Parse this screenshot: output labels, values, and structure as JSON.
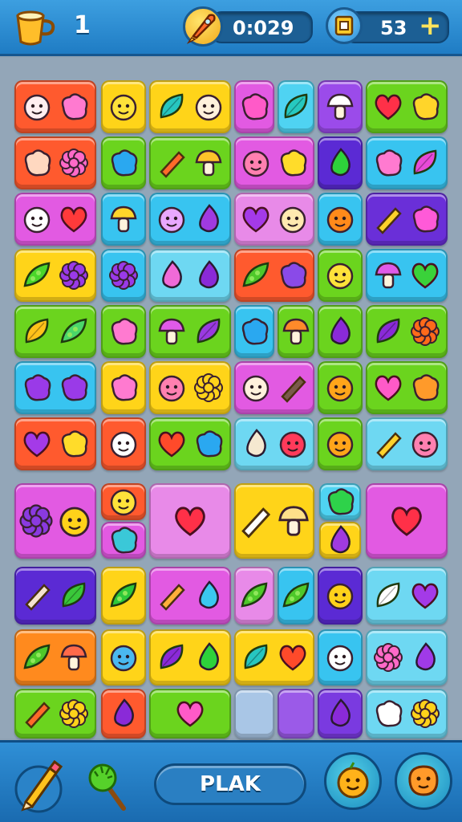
{
  "hud": {
    "level": "1",
    "timer": "0:029",
    "coins": "53"
  },
  "buttons": {
    "main": "PLAK"
  },
  "icons": {
    "top": [
      "cup-icon",
      "rocket-icon",
      "coin-icon",
      "add-icon"
    ],
    "bottom": [
      "pencil-tool-icon",
      "brush-tool-icon",
      "pumpkin-face-icon",
      "orange-face-icon"
    ]
  },
  "colors": {
    "bar": "#1f7cc4",
    "board": "#93a6b8",
    "red": "#ff4b2f",
    "yellow": "#ffd21a",
    "pink": "#e85ad8",
    "cyan": "#35c8f0",
    "green": "#5fd11c",
    "purple": "#7d35e0",
    "orange": "#ff7a1a"
  },
  "tiles": [
    {
      "c": "#ff5a2e",
      "s": [
        "smile-ghost",
        "pink-blob"
      ]
    },
    {
      "c": "#ffd419",
      "s": [
        "yellow-face"
      ]
    },
    {
      "c": "#ffd419",
      "s": [
        "teal-leaf",
        "cream-face"
      ]
    },
    {
      "c": "#e25ae2",
      "s": [
        "pink-splat"
      ]
    },
    {
      "c": "#4fd3f2",
      "s": [
        "teal-leaf-small"
      ]
    },
    {
      "c": "#9b4bea",
      "s": [
        "white-mushroom"
      ]
    },
    {
      "c": "#6bd41e",
      "s": [
        "red-heart",
        "yellow-blob"
      ]
    },
    {
      "c": "#ff5a2e",
      "s": [
        "peach-ghost",
        "pink-flower"
      ]
    },
    {
      "c": "#6bd41e",
      "s": [
        "blue-blob"
      ]
    },
    {
      "c": "#6bd41e",
      "s": [
        "carrot",
        "golden-bell"
      ]
    },
    {
      "c": "#e25ae2",
      "s": [
        "pink-face",
        "yellow-duck"
      ]
    },
    {
      "c": "#5b2ad4",
      "s": [
        "green-drop"
      ]
    },
    {
      "c": "#38c4f0",
      "s": [
        "pink-blob",
        "pink-leaf"
      ]
    },
    {
      "c": "#e25ae2",
      "s": [
        "white-cat",
        "strawberry"
      ]
    },
    {
      "c": "#38c4f0",
      "s": [
        "honey-jar"
      ]
    },
    {
      "c": "#38c4f0",
      "s": [
        "striped-ball",
        "purple-bean"
      ]
    },
    {
      "c": "#e88ae8",
      "s": [
        "purple-heart",
        "cookie"
      ]
    },
    {
      "c": "#38c4f0",
      "s": [
        "orange-pumpkin"
      ]
    },
    {
      "c": "#6a2fd8",
      "s": [
        "corn",
        "pink-cloud"
      ]
    },
    {
      "c": "#ffd419",
      "s": [
        "green-corn",
        "purple-flower"
      ]
    },
    {
      "c": "#38c4f0",
      "s": [
        "purple-flower"
      ]
    },
    {
      "c": "#6ed8f2",
      "s": [
        "pink-bean",
        "purple-eggplant"
      ]
    },
    {
      "c": "#ff5a2e",
      "s": [
        "pea-pod",
        "purple-blob"
      ]
    },
    {
      "c": "#6bd41e",
      "s": [
        "yellow-face"
      ]
    },
    {
      "c": "#38c4f0",
      "s": [
        "pink-mushroom",
        "green-tulip"
      ]
    },
    {
      "c": "#6bd41e",
      "s": [
        "yellow-leaf",
        "green-sock"
      ]
    },
    {
      "c": "#6bd41e",
      "s": [
        "pink-blob"
      ]
    },
    {
      "c": "#6bd41e",
      "s": [
        "pink-mushroom",
        "purple-sprout"
      ]
    },
    {
      "c": "#38c4f0",
      "s": [
        "blue-blob"
      ]
    },
    {
      "c": "#6bd41e",
      "s": [
        "orange-mushroom"
      ]
    },
    {
      "c": "#6bd41e",
      "s": [
        "purple-drop"
      ]
    },
    {
      "c": "#6bd41e",
      "s": [
        "purple-leaf",
        "orange-flower"
      ]
    },
    {
      "c": "#38c4f0",
      "s": [
        "purple-splat",
        "purple-splat"
      ]
    },
    {
      "c": "#ffd419",
      "s": [
        "pink-blob"
      ]
    },
    {
      "c": "#ffd419",
      "s": [
        "pink-face",
        "yellow-flower"
      ]
    },
    {
      "c": "#e25ae2",
      "s": [
        "cream-face",
        "boot"
      ]
    },
    {
      "c": "#6bd41e",
      "s": [
        "orange-face"
      ]
    },
    {
      "c": "#6bd41e",
      "s": [
        "pink-heart",
        "orange-blob"
      ]
    },
    {
      "c": "#ff5a2e",
      "s": [
        "purple-heart",
        "yellow-duck"
      ]
    },
    {
      "c": "#ff5a2e",
      "s": [
        "white-cloud-face"
      ]
    },
    {
      "c": "#6bd41e",
      "s": [
        "red-tulip",
        "blue-blob"
      ]
    },
    {
      "c": "#6ed8f2",
      "s": [
        "coconut",
        "red-face"
      ]
    },
    {
      "c": "#6bd41e",
      "s": [
        "orange-face"
      ]
    },
    {
      "c": "#6ed8f2",
      "s": [
        "corn",
        "pink-face"
      ]
    },
    {
      "c": "#e25ae2",
      "s": [
        "grape",
        "lemon"
      ]
    },
    {
      "c": "#ff5a2e",
      "s": [
        "yellow-face"
      ]
    },
    {
      "c": "#e25ae2",
      "s": [
        "blue-butterfly"
      ]
    },
    {
      "c": "#e88ae8",
      "s": [
        "red-heart"
      ]
    },
    {
      "c": "#ffd419",
      "s": [
        "bone",
        "golden-key"
      ]
    },
    {
      "c": "#4fd3f2",
      "s": [
        "green-apple"
      ]
    },
    {
      "c": "#ffd419",
      "s": [
        "purple-bean"
      ]
    },
    {
      "c": "#e25ae2",
      "s": [
        "red-heart"
      ]
    },
    {
      "c": "#5b2ad4",
      "s": [
        "paper-roll",
        "green-leaf"
      ]
    },
    {
      "c": "#ffd419",
      "s": [
        "green-sprouts"
      ]
    },
    {
      "c": "#e25ae2",
      "s": [
        "ruler",
        "blue-drop"
      ]
    },
    {
      "c": "#e88ae8",
      "s": [
        "pea-pod"
      ]
    },
    {
      "c": "#38c4f0",
      "s": [
        "pea-pod"
      ]
    },
    {
      "c": "#5b2ad4",
      "s": [
        "honey-face"
      ]
    },
    {
      "c": "#6ed8f2",
      "s": [
        "white-feather",
        "purple-heart"
      ]
    },
    {
      "c": "#ff8a1e",
      "s": [
        "pea-pod",
        "mallet"
      ]
    },
    {
      "c": "#ffd419",
      "s": [
        "blue-face"
      ]
    },
    {
      "c": "#ffd419",
      "s": [
        "purple-leaf",
        "green-drop"
      ]
    },
    {
      "c": "#ffd419",
      "s": [
        "teal-leaf",
        "red-tulip"
      ]
    },
    {
      "c": "#38c4f0",
      "s": [
        "white-duck"
      ]
    },
    {
      "c": "#6ed8f2",
      "s": [
        "pink-flower",
        "purple-balloon"
      ]
    },
    {
      "c": "#6bd41e",
      "s": [
        "carrot",
        "yellow-flower"
      ]
    },
    {
      "c": "#ff5a2e",
      "s": [
        "purple-eggplant"
      ]
    },
    {
      "c": "#6bd41e",
      "s": [
        "pink-heart"
      ]
    },
    {
      "c": "#a9c6e6",
      "s": []
    },
    {
      "c": "#9b5ae8",
      "s": []
    },
    {
      "c": "#7a3ae0",
      "s": [
        "purple-eggplant"
      ]
    },
    {
      "c": "#6ed8f2",
      "s": [
        "white-wing",
        "yellow-flower"
      ]
    }
  ]
}
